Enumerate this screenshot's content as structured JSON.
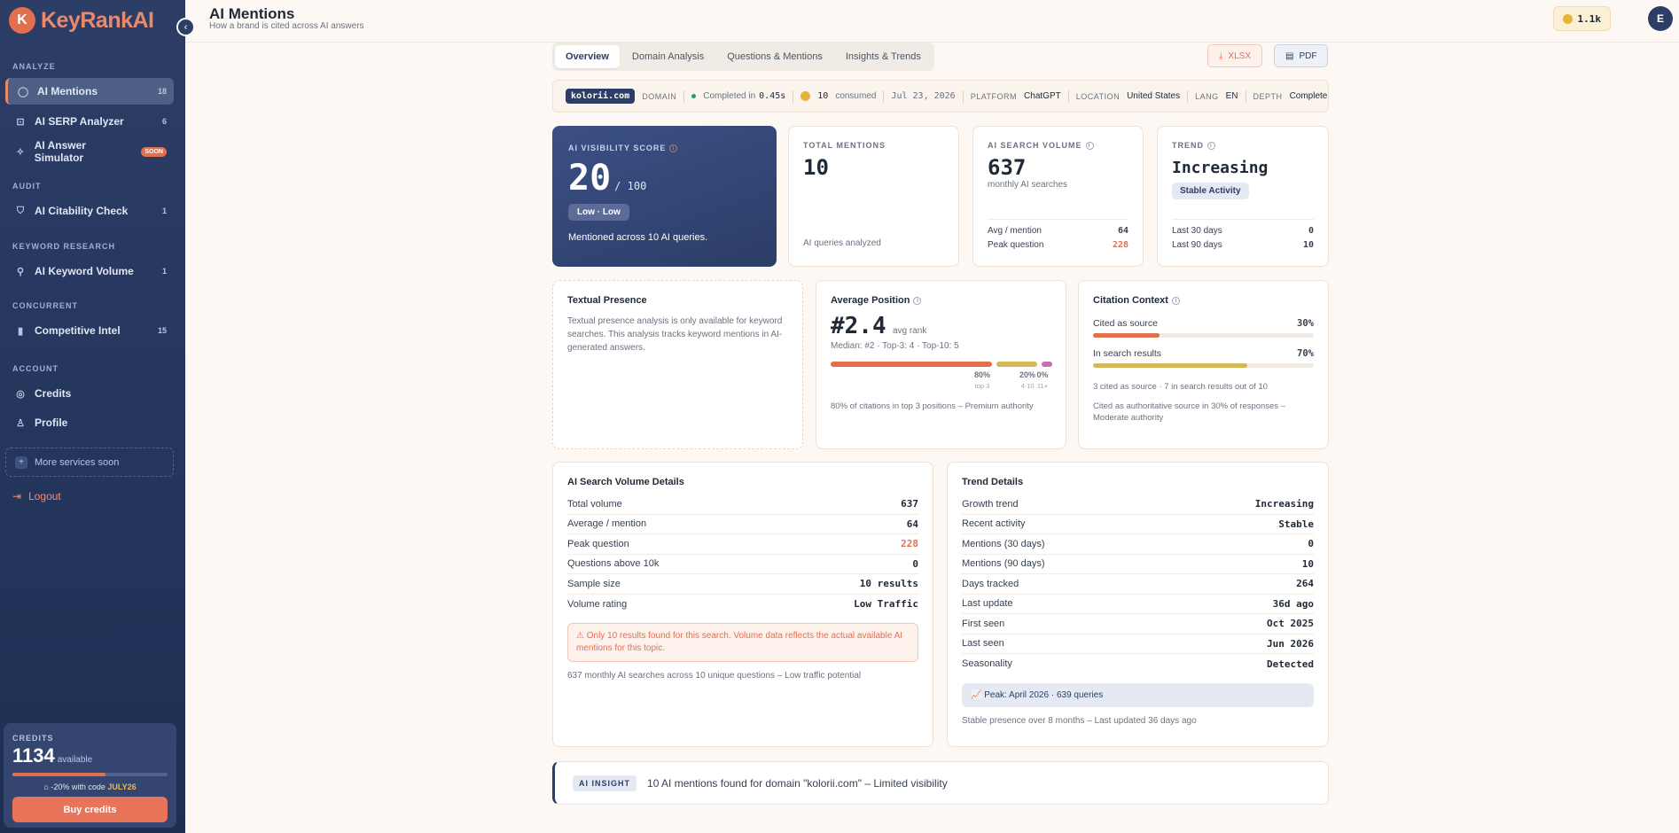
{
  "brand": {
    "logo_mark": "K",
    "name": "KeyRankAI",
    "accent": "#e2704f",
    "navy": "#2c3d66"
  },
  "sidebar": {
    "sections": {
      "analyze": "ANALYZE",
      "audit": "AUDIT",
      "keyword": "KEYWORD RESEARCH",
      "concurrent": "CONCURRENT",
      "account": "ACCOUNT"
    },
    "items": [
      {
        "label": "AI Mentions",
        "count": "18",
        "icon": "chat-icon"
      },
      {
        "label": "AI SERP Analyzer",
        "count": "6",
        "icon": "scan-icon"
      },
      {
        "label": "AI Answer Simulator",
        "badge": "SOON",
        "icon": "sparkle-icon"
      },
      {
        "label": "AI Citability Check",
        "count": "1",
        "icon": "shield-icon"
      },
      {
        "label": "AI Keyword Volume",
        "count": "1",
        "icon": "search-icon"
      },
      {
        "label": "Competitive Intel",
        "count": "15",
        "icon": "bars-icon"
      },
      {
        "label": "Credits",
        "icon": "coin-icon"
      },
      {
        "label": "Profile",
        "icon": "user-icon"
      }
    ],
    "more_services": "More services soon",
    "logout": "Logout",
    "credits": {
      "label": "CREDITS",
      "amount": "1134",
      "available": "available",
      "fill": 0.6,
      "promo_prefix": "-20% with code",
      "promo_code": "JULY26",
      "buy_label": "Buy credits"
    }
  },
  "header": {
    "title": "AI Mentions",
    "subtitle": "How a brand is cited across AI answers",
    "credits_pill": "1.1k",
    "avatar": "E"
  },
  "tabs": [
    "Overview",
    "Domain Analysis",
    "Questions & Mentions",
    "Insights & Trends"
  ],
  "export": {
    "xlsx": "XLSX",
    "pdf": "PDF"
  },
  "meta": {
    "domain": "kolorii.com",
    "domain_label": "DOMAIN",
    "completed_prefix": "Completed in",
    "completed_time": "0.45s",
    "consumed_count": "10",
    "consumed_label": "consumed",
    "date": "Jul 23, 2026",
    "platform_label": "PLATFORM",
    "platform": "ChatGPT",
    "location_label": "LOCATION",
    "location": "United States",
    "lang_label": "LANG",
    "lang": "EN",
    "depth_label": "DEPTH",
    "depth": "Complete"
  },
  "visibility": {
    "label": "AI VISIBILITY SCORE",
    "score": "20",
    "max": "/ 100",
    "badge": "Low · Low",
    "note": "Mentioned across 10 AI queries."
  },
  "total_mentions": {
    "label": "TOTAL MENTIONS",
    "value": "10",
    "foot": "AI queries analyzed"
  },
  "search_volume": {
    "label": "AI SEARCH VOLUME",
    "value": "637",
    "sub": "monthly AI searches",
    "avg_label": "Avg / mention",
    "avg": "64",
    "peak_label": "Peak question",
    "peak": "228"
  },
  "trend": {
    "label": "TREND",
    "value": "Increasing",
    "pill": "Stable Activity",
    "d30_label": "Last 30 days",
    "d30": "0",
    "d90_label": "Last 90 days",
    "d90": "10"
  },
  "textual": {
    "title": "Textual Presence",
    "text": "Textual presence analysis is only available for keyword searches. This analysis tracks keyword mentions in AI-generated answers."
  },
  "avg_position": {
    "title": "Average Position",
    "value": "#2.4",
    "unit": "avg rank",
    "median": "Median: #2 · Top-3: 4 · Top-10: 5",
    "segments": [
      {
        "pct": "80%",
        "label": "top 3",
        "share": 0.8,
        "color": "#e2704f"
      },
      {
        "pct": "20%",
        "label": "4-10",
        "share": 0.2,
        "color": "#d4b85a"
      },
      {
        "pct": "0%",
        "label": "11+",
        "share": 0.0,
        "color": "#c76fb1"
      }
    ],
    "note": "80% of citations in top 3 positions – Premium authority"
  },
  "citation": {
    "title": "Citation Context",
    "source_label": "Cited as source",
    "source_pct": "30%",
    "source_share": 0.3,
    "search_label": "In search results",
    "search_pct": "70%",
    "search_share": 0.7,
    "summary": "3 cited as source · 7 in search results out of 10",
    "note": "Cited as authoritative source in 30% of responses – Moderate authority"
  },
  "volume_details": {
    "title": "AI Search Volume Details",
    "rows": [
      {
        "k": "Total volume",
        "v": "637"
      },
      {
        "k": "Average / mention",
        "v": "64"
      },
      {
        "k": "Peak question",
        "v": "228"
      },
      {
        "k": "Questions above 10k",
        "v": "0"
      },
      {
        "k": "Sample size",
        "v": "10 results"
      },
      {
        "k": "Volume rating",
        "v": "Low Traffic"
      }
    ],
    "warning": "⚠ Only 10 results found for this search. Volume data reflects the actual available AI mentions for this topic.",
    "foot": "637 monthly AI searches across 10 unique questions – Low traffic potential"
  },
  "trend_details": {
    "title": "Trend Details",
    "rows": [
      {
        "k": "Growth trend",
        "v": "Increasing"
      },
      {
        "k": "Recent activity",
        "v": "Stable"
      },
      {
        "k": "Mentions (30 days)",
        "v": "0"
      },
      {
        "k": "Mentions (90 days)",
        "v": "10"
      },
      {
        "k": "Days tracked",
        "v": "264"
      },
      {
        "k": "Last update",
        "v": "36d ago"
      },
      {
        "k": "First seen",
        "v": "Oct 2025"
      },
      {
        "k": "Last seen",
        "v": "Jun 2026"
      },
      {
        "k": "Seasonality",
        "v": "Detected"
      }
    ],
    "peak": "📈 Peak: April 2026 · 639 queries",
    "foot": "Stable presence over 8 months – Last updated 36 days ago"
  },
  "insight": {
    "tag": "AI INSIGHT",
    "text": "10 AI mentions found for domain \"kolorii.com\" – Limited visibility"
  }
}
